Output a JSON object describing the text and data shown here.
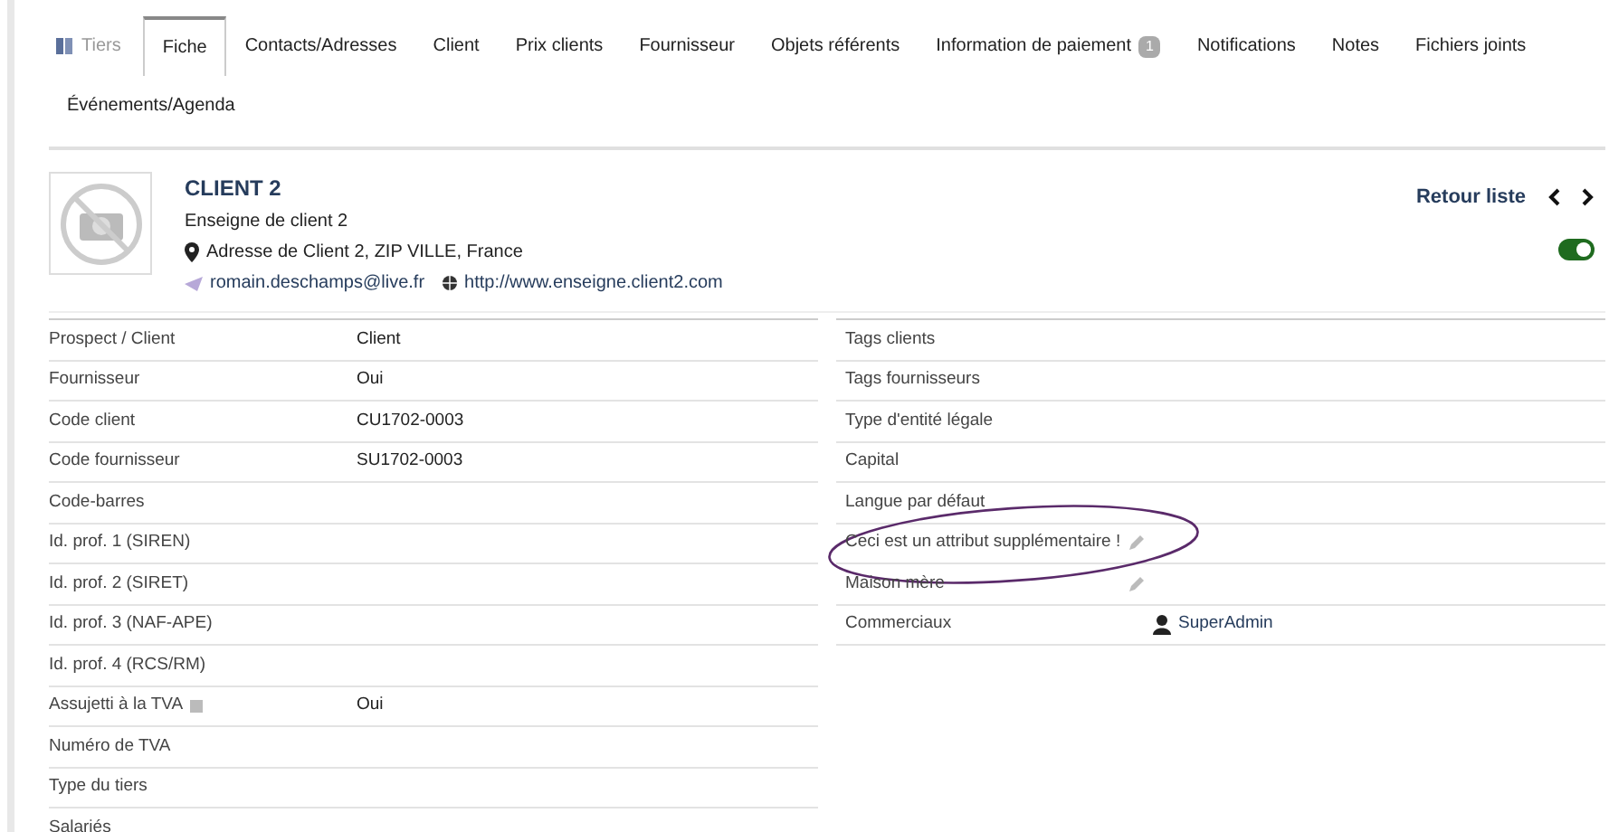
{
  "tabs": [
    {
      "kind": "title",
      "label": "Tiers",
      "selected": false
    },
    {
      "kind": "tab",
      "label": "Fiche",
      "selected": true
    },
    {
      "kind": "tab",
      "label": "Contacts/Adresses",
      "selected": false
    },
    {
      "kind": "tab",
      "label": "Client",
      "selected": false
    },
    {
      "kind": "tab",
      "label": "Prix clients",
      "selected": false
    },
    {
      "kind": "tab",
      "label": "Fournisseur",
      "selected": false
    },
    {
      "kind": "tab",
      "label": "Objets référents",
      "selected": false
    },
    {
      "kind": "tab",
      "label": "Information de paiement",
      "badge": "1",
      "selected": false
    },
    {
      "kind": "tab",
      "label": "Notifications",
      "selected": false
    },
    {
      "kind": "tab",
      "label": "Notes",
      "selected": false
    },
    {
      "kind": "tab",
      "label": "Fichiers joints",
      "selected": false
    },
    {
      "kind": "tab",
      "label": "Événements/Agenda",
      "selected": false
    }
  ],
  "header": {
    "name": "CLIENT 2",
    "brand": "Enseigne de client 2",
    "address": "Adresse de Client 2, ZIP VILLE, France",
    "email": "romain.deschamps@live.fr",
    "website": "http://www.enseigne.client2.com",
    "back_link": "Retour liste",
    "active": true
  },
  "left_fields": [
    {
      "label": "Prospect / Client",
      "value": "Client"
    },
    {
      "label": "Fournisseur",
      "value": "Oui"
    },
    {
      "label": "Code client",
      "value": "CU1702-0003"
    },
    {
      "label": "Code fournisseur",
      "value": "SU1702-0003"
    },
    {
      "label": "Code-barres"
    },
    {
      "label": "Id. prof. 1 (SIREN)"
    },
    {
      "label": "Id. prof. 2 (SIRET)"
    },
    {
      "label": "Id. prof. 3 (NAF-APE)"
    },
    {
      "label": "Id. prof. 4 (RCS/RM)"
    },
    {
      "label": "Assujetti à la TVA",
      "info": true,
      "value": "Oui"
    },
    {
      "label": "Numéro de TVA"
    },
    {
      "label": "Type du tiers"
    },
    {
      "label": "Salariés"
    }
  ],
  "right_fields": [
    {
      "label": "Tags clients",
      "editable": false
    },
    {
      "label": "Tags fournisseurs",
      "editable": false
    },
    {
      "label": "Type d'entité légale",
      "editable": false
    },
    {
      "label": "Capital",
      "editable": false
    },
    {
      "label": "Langue par défaut",
      "editable": false
    },
    {
      "label": "Ceci est un attribut supplémentaire !",
      "editable": true,
      "circled": true
    },
    {
      "label": "Maison mère",
      "editable": true
    },
    {
      "label": "Commerciaux",
      "editable": false,
      "user": "SuperAdmin"
    }
  ]
}
